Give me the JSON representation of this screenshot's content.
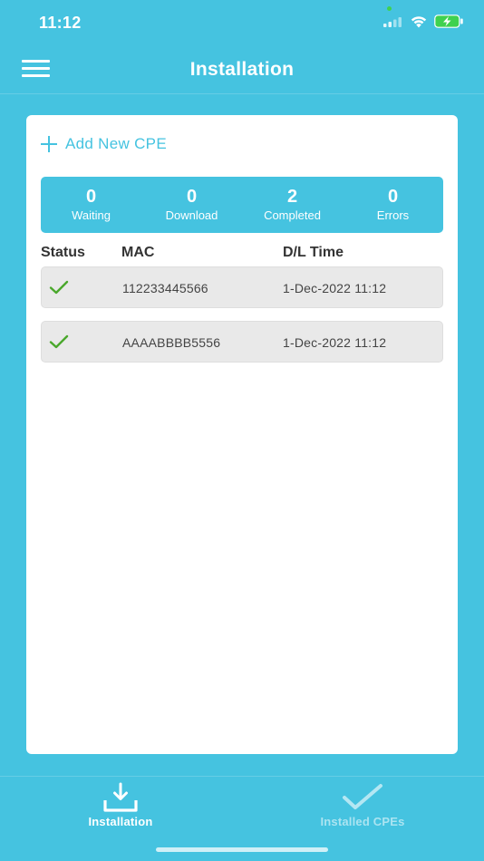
{
  "status_bar": {
    "time": "11:12"
  },
  "header": {
    "title": "Installation",
    "menu_icon": "hamburger-menu-icon"
  },
  "card": {
    "add_cpe_label": "Add New CPE",
    "summary": [
      {
        "count": "0",
        "label": "Waiting"
      },
      {
        "count": "0",
        "label": "Download"
      },
      {
        "count": "2",
        "label": "Completed"
      },
      {
        "count": "0",
        "label": "Errors"
      }
    ],
    "table": {
      "headers": {
        "status": "Status",
        "mac": "MAC",
        "time": "D/L Time"
      },
      "rows": [
        {
          "status": "completed",
          "status_icon": "checkmark-icon",
          "mac": "112233445566",
          "time": "1-Dec-2022 11:12"
        },
        {
          "status": "completed",
          "status_icon": "checkmark-icon",
          "mac": "AAAABBBB5556",
          "time": "1-Dec-2022 11:12"
        }
      ]
    }
  },
  "tabbar": {
    "tabs": [
      {
        "label": "Installation",
        "icon": "download-tray-icon",
        "active": true
      },
      {
        "label": "Installed CPEs",
        "icon": "checkmark-icon",
        "active": false
      }
    ]
  },
  "colors": {
    "brand": "#45c3e0",
    "check": "#4aa82c",
    "row_bg": "#e9e9e9"
  }
}
